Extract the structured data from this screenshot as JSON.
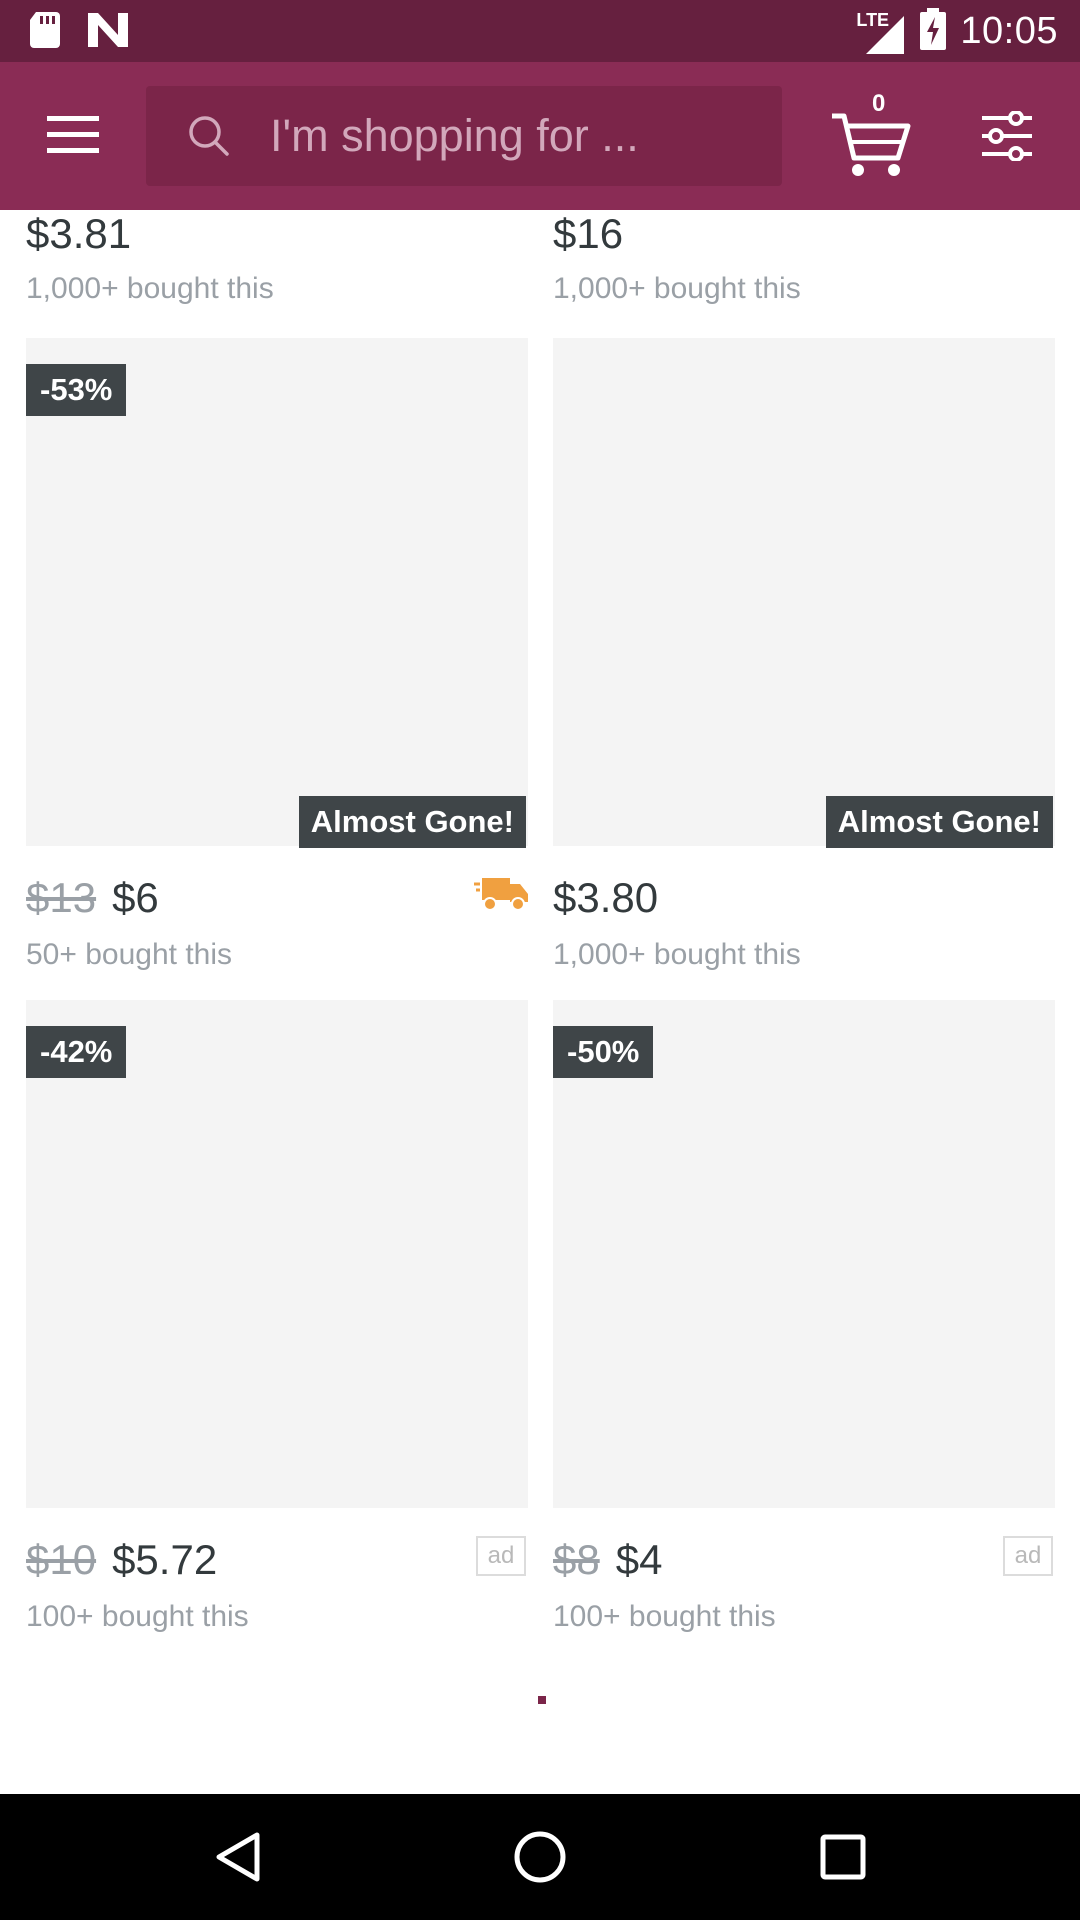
{
  "status_bar": {
    "network": "LTE",
    "time": "10:05"
  },
  "app_bar": {
    "search_placeholder": "I'm shopping for ...",
    "cart_count": "0"
  },
  "products_top": [
    {
      "price": "$3.81",
      "sold": "1,000+ bought this"
    },
    {
      "price": "$16",
      "sold": "1,000+ bought this"
    }
  ],
  "products_row2": [
    {
      "discount": "-53%",
      "badge": "Almost Gone!",
      "old_price": "$13",
      "price": "$6",
      "sold": "50+ bought this",
      "icon": "delivery-truck-icon"
    },
    {
      "badge": "Almost Gone!",
      "price": "$3.80",
      "sold": "1,000+ bought this"
    }
  ],
  "products_row3": [
    {
      "discount": "-42%",
      "old_price": "$10",
      "price": "$5.72",
      "sold": "100+ bought this",
      "ad": "ad"
    },
    {
      "discount": "-50%",
      "old_price": "$8",
      "price": "$4",
      "sold": "100+ bought this",
      "ad": "ad"
    }
  ],
  "colors": {
    "status_bar": "#66203f",
    "app_bar": "#8a2c55",
    "badge": "#3f4548",
    "truck": "#f0a040"
  }
}
